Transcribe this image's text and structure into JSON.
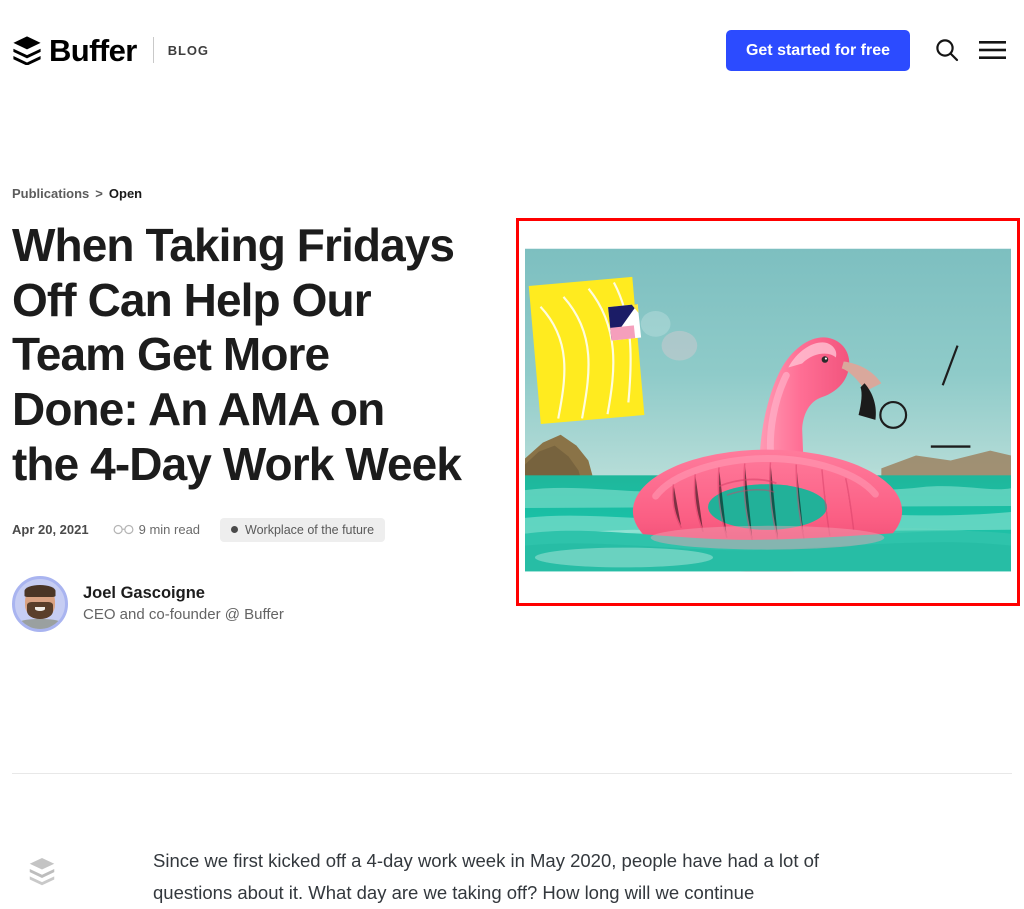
{
  "header": {
    "brand_name": "Buffer",
    "brand_section": "BLOG",
    "brand_mark_icon": "buffer-layers-icon",
    "cta_label": "Get started for free",
    "cta_color": "#2c4bff",
    "search_icon": "search-icon",
    "menu_icon": "hamburger-menu-icon"
  },
  "breadcrumb": {
    "parent": "Publications",
    "separator": ">",
    "current": "Open"
  },
  "article": {
    "title": "When Taking Fridays Off Can Help Our Team Get More Done: An AMA on the 4-Day Work Week",
    "date": "Apr 20, 2021",
    "read_time": "9 min read",
    "read_time_icon": "glasses-icon",
    "tag": "Workplace of the future",
    "tag_dot_color": "#4a4a4a",
    "tag_background": "#eeeeee"
  },
  "author": {
    "name": "Joel Gascoigne",
    "role": "CEO and co-founder @ Buffer",
    "avatar_icon": "avatar",
    "avatar_ring_color": "#a9b4f0"
  },
  "hero_image": {
    "alt": "Pink inflatable flamingo pool float on teal ocean water with yellow collage shapes",
    "highlight_border_color": "#ff0000"
  },
  "body": {
    "watermark_icon": "buffer-layers-watermark-icon",
    "paragraph": "Since we first kicked off a 4-day work week in May 2020, people have had a lot of questions about it. What day are we taking off? How long will we continue"
  }
}
